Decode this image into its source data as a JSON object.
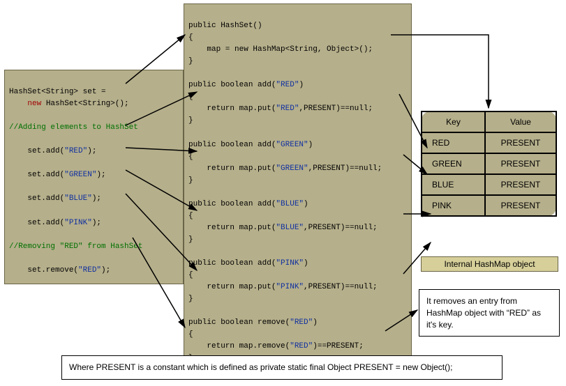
{
  "left_box": {
    "line1a": "HashSet<String> set = ",
    "line1b": "    new",
    "line1c": " HashSet<String>();",
    "comment1": "//Adding elements to HashSet",
    "add1a": "    set.add(",
    "add1s": "\"RED\"",
    "add1b": ");",
    "add2a": "    set.add(",
    "add2s": "\"GREEN\"",
    "add2b": ");",
    "add3a": "    set.add(",
    "add3s": "\"BLUE\"",
    "add3b": ");",
    "add4a": "    set.add(",
    "add4s": "\"PINK\"",
    "add4b": ");",
    "comment2": "//Removing \"RED\" from HashSet",
    "rem1a": "    set.remove(",
    "rem1s": "\"RED\"",
    "rem1b": ");"
  },
  "mid_box": {
    "ctor_sig": "public HashSet()",
    "ctor_body": "    map = new HashMap<String, Object>();",
    "add_red_sig": "public boolean add(",
    "add_red_arg": "\"RED\"",
    "add_red_body1": "    return map.put(",
    "add_red_body2": ",PRESENT)==null;",
    "add_green_sig": "public boolean add(",
    "add_green_arg": "\"GREEN\"",
    "add_green_body1": "    return map.put(",
    "add_green_body2": ",PRESENT)==null;",
    "add_blue_sig": "public boolean add(",
    "add_blue_arg": "\"BLUE\"",
    "add_blue_body1": "    return map.put(",
    "add_blue_body2": ",PRESENT)==null;",
    "add_pink_sig": "public boolean add(",
    "add_pink_arg": "\"PINK\"",
    "add_pink_body1": "    return map.put(",
    "add_pink_body2": ",PRESENT)==null;",
    "rem_sig": "public boolean remove(",
    "rem_arg": "\"RED\"",
    "rem_body1": "    return map.remove(",
    "rem_body2": ")==PRESENT;",
    "brace_open": "{",
    "brace_close": "}",
    "paren_close": ")"
  },
  "table": {
    "headers": {
      "key": "Key",
      "value": "Value"
    },
    "rows": [
      {
        "key": "RED",
        "value": "PRESENT"
      },
      {
        "key": "GREEN",
        "value": "PRESENT"
      },
      {
        "key": "BLUE",
        "value": "PRESENT"
      },
      {
        "key": "PINK",
        "value": "PRESENT"
      }
    ],
    "caption": "Internal HashMap object"
  },
  "remove_note": "It removes an entry from HashMap object with “RED” as it's key.",
  "footer_note": "Where PRESENT is a constant which is defined as private static final Object PRESENT = new Object();"
}
